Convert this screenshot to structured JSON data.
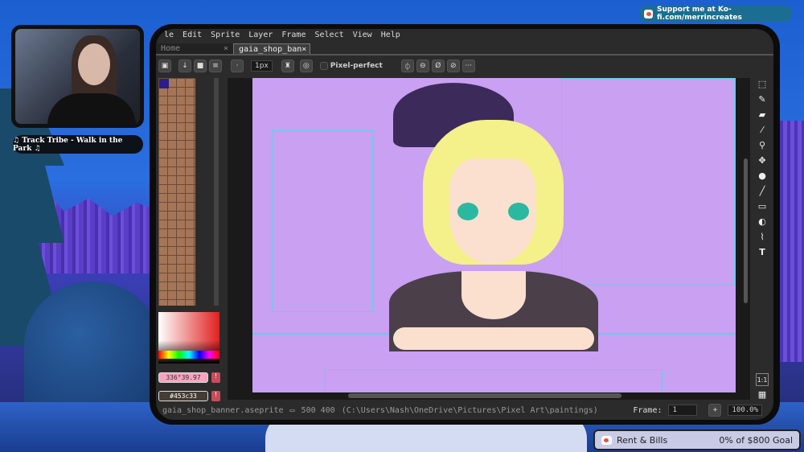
{
  "overlay": {
    "song": "♫ Track Tribe - Walk in the Park ♫",
    "kofi": "Support me at Ko-fi.com/merrincreates",
    "goal_label": "Rent & Bills",
    "goal_progress": "0% of $800 Goal",
    "goal_percent": 0
  },
  "app": {
    "menu": [
      "le",
      "Edit",
      "Sprite",
      "Layer",
      "Frame",
      "Select",
      "View",
      "Help"
    ],
    "tabs": [
      {
        "label": "Home",
        "close": "×"
      },
      {
        "label": "gaia_shop_ban",
        "close": "×"
      }
    ],
    "toolbar": {
      "brush_size": "1px",
      "pixel_perfect": "Pixel-perfect",
      "more": "···"
    },
    "colors": {
      "fg_value": "336°39.97",
      "bg_value": "#453c33",
      "fg_hex": "#f4a6c0",
      "bg_hex": "#453c33"
    },
    "status": {
      "filename": "gaia_shop_banner.aseprite",
      "size": "500 400",
      "path": "(C:\\Users\\Nash\\OneDrive\\Pictures\\Pixel Art\\paintings)",
      "frame_label": "Frame:",
      "frame": "1",
      "plus": "+",
      "zoom": "100.0%"
    },
    "tools": [
      "marquee",
      "pencil",
      "eraser",
      "eyedropper",
      "zoom",
      "move",
      "fill",
      "line",
      "rectangle",
      "blur",
      "smudge",
      "text"
    ]
  }
}
